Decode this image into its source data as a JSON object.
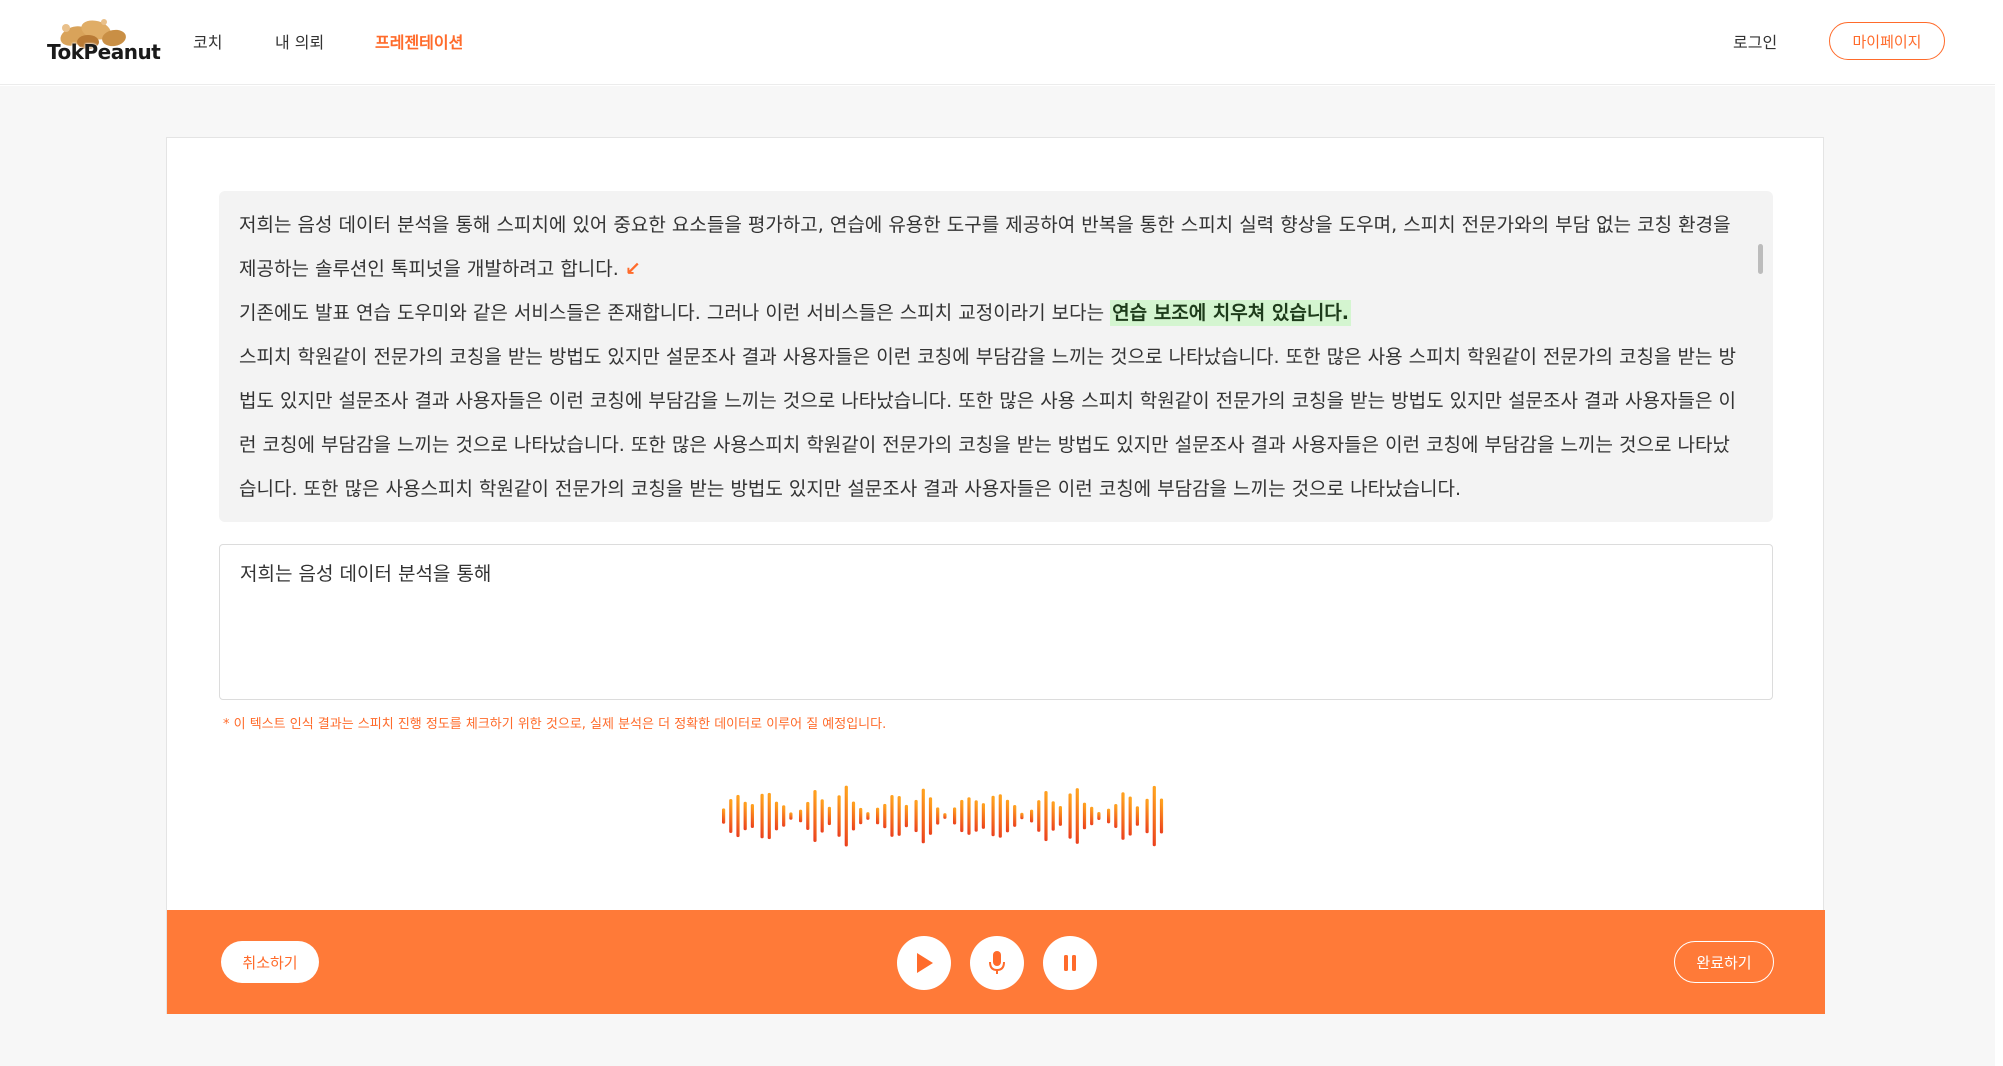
{
  "header": {
    "logo_text": "TokPeanut",
    "nav": [
      {
        "label": "코치"
      },
      {
        "label": "내 의뢰"
      },
      {
        "label": "프레젠테이션"
      }
    ],
    "login_label": "로그인",
    "mypage_label": "마이페이지"
  },
  "script": {
    "line1": "저희는 음성 데이터 분석을 통해 스피치에 있어 중요한 요소들을 평가하고, 연습에 유용한 도구를 제공하여 반복을 통한 스피치 실력 향상을 도우며, 스피치 전문가와의 부담 없는 코칭 환경을 제공하는 솔루션인 톡피넛을 개발하려고 합니다.",
    "line2_prefix": "기존에도 발표 연습 도우미와 같은 서비스들은 존재합니다. 그러나 이런 서비스들은 스피치 교정이라기 보다는",
    "line2_highlight": "연습 보조에 치우쳐 있습니다.",
    "line3": "스피치 학원같이 전문가의 코칭을 받는 방법도 있지만 설문조사 결과 사용자들은 이런 코칭에 부담감을 느끼는 것으로 나타났습니다. 또한 많은 사용 스피치 학원같이 전문가의 코칭을 받는 방법도 있지만 설문조사 결과 사용자들은 이런 코칭에 부담감을 느끼는 것으로 나타났습니다. 또한 많은 사용 스피치 학원같이 전문가의 코칭을 받는 방법도 있지만 설문조사 결과 사용자들은 이런 코칭에 부담감을 느끼는 것으로 나타났습니다. 또한 많은 사용스피치 학원같이 전문가의 코칭을 받는 방법도 있지만 설문조사 결과 사용자들은 이런 코칭에 부담감을 느끼는 것으로 나타났습니다. 또한 많은 사용스피치 학원같이 전문가의 코칭을 받는 방법도 있지만 설문조사 결과 사용자들은 이런 코칭에 부담감을 느끼는 것으로 나타났습니다.",
    "marker_icon": "arrow-down-left-icon"
  },
  "recognition": {
    "text": "저희는 음성 데이터 분석을 통해"
  },
  "notice": "* 이 텍스트 인식 결과는 스피치 진행 정도를 체크하기 위한 것으로,  실제 분석은 더 정확한 데이터로 이루어 질 예정입니다.",
  "controls": {
    "cancel_label": "취소하기",
    "done_label": "완료하기",
    "play_icon": "play-icon",
    "mic_icon": "microphone-icon",
    "pause_icon": "pause-icon"
  },
  "colors": {
    "accent": "#ff6b2b",
    "control_bar": "#ff7a38",
    "highlight": "#d4f5d0",
    "wave_start": "#e8321e",
    "wave_end": "#ffa21f"
  }
}
